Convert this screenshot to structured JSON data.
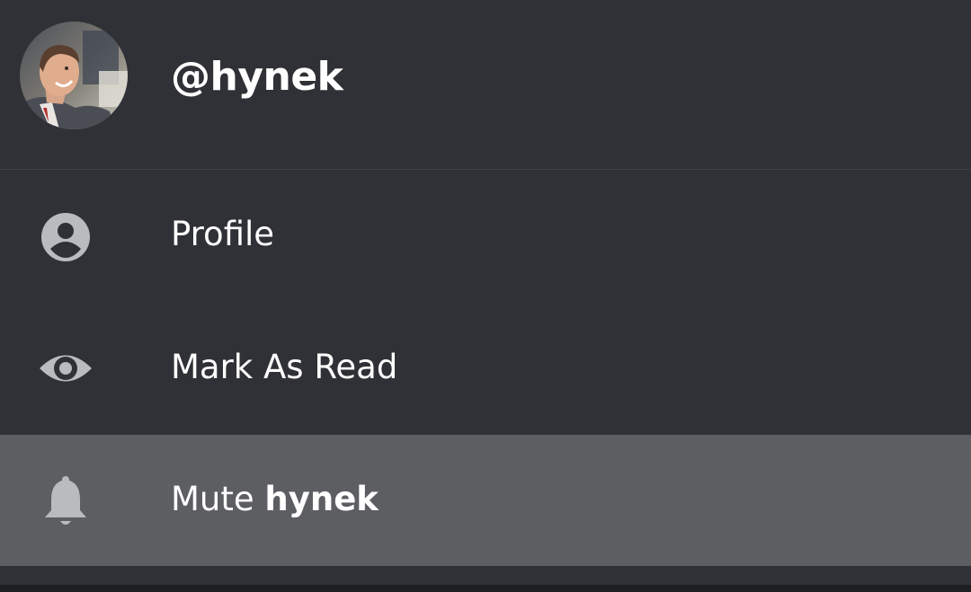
{
  "profile": {
    "username": "@hynek"
  },
  "menu": {
    "items": [
      {
        "icon": "user-circle-icon",
        "label": "Profile"
      },
      {
        "icon": "eye-icon",
        "label": "Mark As Read"
      },
      {
        "icon": "bell-icon",
        "label_prefix": "Mute ",
        "label_name": "hynek"
      }
    ]
  },
  "colors": {
    "background": "#2f3136",
    "highlight": "#5c5e62",
    "icon": "#b9bbbe",
    "text": "#ffffff"
  }
}
